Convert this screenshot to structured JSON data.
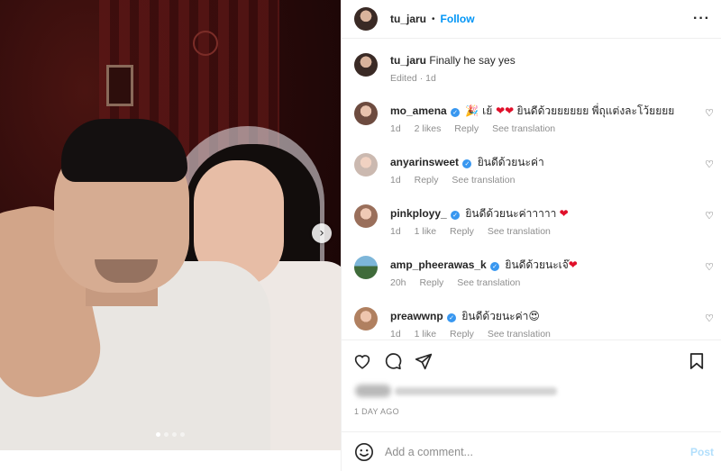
{
  "post": {
    "author": "tu_jaru",
    "follow_label": "Follow",
    "separator": "•",
    "more_label": "···"
  },
  "media": {
    "next_arrow": "›",
    "carousel_dots": 4,
    "active_dot": 0
  },
  "caption": {
    "username": "tu_jaru",
    "text": "Finally he say yes",
    "meta": "Edited · 1d"
  },
  "comments": [
    {
      "username": "mo_amena",
      "verified": true,
      "text_pre": "🎉 เย้ ",
      "hearts": "❤❤",
      "text_post": " ยินดีด้วยยยยยย พี่ถุแต่งละโว้ยยยย",
      "time": "1d",
      "likes": "2 likes",
      "reply": "Reply",
      "translate": "See translation"
    },
    {
      "username": "anyarinsweet",
      "verified": true,
      "text_pre": "ยินดีด้วยนะค่า",
      "hearts": "",
      "text_post": "",
      "time": "1d",
      "likes": "",
      "reply": "Reply",
      "translate": "See translation"
    },
    {
      "username": "pinkployy_",
      "verified": true,
      "text_pre": "ยินดีด้วยนะค่าาาาา ",
      "hearts": "❤",
      "text_post": "",
      "time": "1d",
      "likes": "1 like",
      "reply": "Reply",
      "translate": "See translation"
    },
    {
      "username": "amp_pheerawas_k",
      "verified": true,
      "text_pre": "ยินดีด้วยนะเจ๊",
      "hearts": "❤",
      "text_post": "",
      "time": "20h",
      "likes": "",
      "reply": "Reply",
      "translate": "See translation"
    },
    {
      "username": "preawwnp",
      "verified": true,
      "text_pre": "ยินดีด้วยนะค่า",
      "hearts": "",
      "text_post": "😍",
      "time": "1d",
      "likes": "1 like",
      "reply": "Reply",
      "translate": "See translation"
    }
  ],
  "like_icon": "♡",
  "footer": {
    "date": "1 DAY AGO",
    "comment_placeholder": "Add a comment...",
    "post_label": "Post"
  },
  "colors": {
    "accent": "#0095f6",
    "post_disabled": "#b2dffc",
    "heart": "#e0102a",
    "verified": "#3897f0"
  }
}
